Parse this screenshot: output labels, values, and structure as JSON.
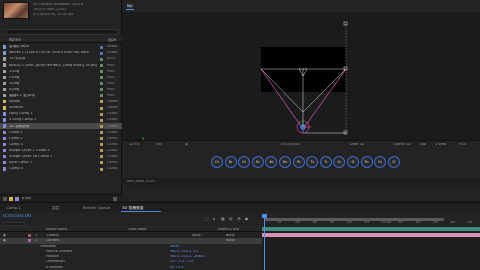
{
  "project": {
    "meta_lines": [
      "3D Camera Animation 2023 ▾",
      "1920 x 1080 (1.00)",
      "Δ 0;00;05;00, 30.00 fps"
    ],
    "header": {
      "name": "Name",
      "type": "Type"
    },
    "items": [
      {
        "name": "香港街.mp4",
        "type": "Video",
        "icon": "video-icon",
        "color": "#7aa0d8",
        "swatch": "#5c6fa8"
      },
      {
        "name": "secret-1 (1280×720 to 1920×1080 hd).mp4",
        "type": "Video",
        "icon": "video-icon",
        "color": "#7aa0d8",
        "swatch": "#5c6fa8"
      },
      {
        "name": "1278.jpg",
        "type": "JPEG",
        "icon": "image-icon",
        "color": "#a0a0a0",
        "swatch": "#6a8a6a"
      },
      {
        "name": "88810-1 (blur, guffy territory, [long shot]), kt.png",
        "type": "PNG",
        "icon": "image-icon",
        "color": "#a0a0a0",
        "swatch": "#6a8a6a"
      },
      {
        "name": "1.png",
        "type": "PNG",
        "icon": "image-icon",
        "color": "#a0a0a0",
        "swatch": "#6a8a6a"
      },
      {
        "name": "2.png",
        "type": "PNG",
        "icon": "image-icon",
        "color": "#a0a0a0",
        "swatch": "#6a8a6a"
      },
      {
        "name": "3.png",
        "type": "PNG",
        "icon": "image-icon",
        "color": "#a0a0a0",
        "swatch": "#6a8a6a"
      },
      {
        "name": "4.png",
        "type": "PNG",
        "icon": "image-icon",
        "color": "#a0a0a0",
        "swatch": "#6a8a6a"
      },
      {
        "name": "縮圖4-1 邊.png",
        "type": "PNG",
        "icon": "image-icon",
        "color": "#a0a0a0",
        "swatch": "#6a8a6a"
      },
      {
        "name": "Solids",
        "type": "Folder",
        "icon": "folder-icon",
        "color": "#d9b84a",
        "swatch": "#c2a03e"
      },
      {
        "name": "untitled",
        "type": "Folder",
        "icon": "folder-icon",
        "color": "#d9b84a",
        "swatch": "#c2a03e"
      },
      {
        "name": "Long Comp 1",
        "type": "Comp",
        "icon": "comp-icon",
        "color": "#8a8ad8",
        "swatch": "#b59a5a"
      },
      {
        "name": "3 Long Comp 1",
        "type": "Comp",
        "icon": "comp-icon",
        "color": "#8a8ad8",
        "swatch": "#b59a5a"
      },
      {
        "name": "3D 相機動畫",
        "type": "Comp",
        "icon": "comp-icon",
        "color": "#8a8ad8",
        "swatch": "#b59a5a",
        "selected": true
      },
      {
        "name": "Comp 1",
        "type": "Comp",
        "icon": "comp-icon",
        "color": "#8a8ad8",
        "swatch": "#b59a5a"
      },
      {
        "name": "Comp 2",
        "type": "Comp",
        "icon": "comp-icon",
        "color": "#8a8ad8",
        "swatch": "#b59a5a"
      },
      {
        "name": "Comp 3",
        "type": "Comp",
        "icon": "comp-icon",
        "color": "#8a8ad8",
        "swatch": "#b59a5a"
      },
      {
        "name": "Shape Layer 1 Comp 1",
        "type": "Comp",
        "icon": "comp-icon",
        "color": "#8a8ad8",
        "swatch": "#b59a5a"
      },
      {
        "name": "Shape Layer 16 Comp 1",
        "type": "Comp",
        "icon": "comp-icon",
        "color": "#8a8ad8",
        "swatch": "#b59a5a"
      },
      {
        "name": "slice Comp 1",
        "type": "Comp",
        "icon": "comp-icon",
        "color": "#8a8ad8",
        "swatch": "#b59a5a"
      },
      {
        "name": "Comp 4",
        "type": "Comp",
        "icon": "comp-icon",
        "color": "#8a8ad8",
        "swatch": "#b59a5a"
      }
    ],
    "footer": {
      "bpc": "8 bpc"
    }
  },
  "viewer": {
    "tab": "Top",
    "toolbar": {
      "zoom": "12.5%",
      "resolution": "Full",
      "timecode": "0;00;00;00",
      "draft": "Draft 3D",
      "renderer": "Classic 3D",
      "view": "Top",
      "views": "1 View",
      "offset": "+0.0"
    },
    "status": "ddm_pack_0230"
  },
  "tools": [
    {
      "label": "Cn",
      "icon": "camera-tool-icon"
    },
    {
      "label": "Br",
      "icon": "brush-tool-icon"
    },
    {
      "label": "Dr",
      "icon": "draw-tool-icon"
    },
    {
      "label": "Rc",
      "icon": "record-tool-icon"
    },
    {
      "label": "Ad",
      "icon": "adjust-tool-icon"
    },
    {
      "label": "Mx",
      "icon": "mix-tool-icon"
    },
    {
      "label": "Rt",
      "icon": "rotate-tool-icon"
    },
    {
      "label": "Tx",
      "icon": "text-tool-icon"
    },
    {
      "label": "Tr",
      "icon": "track-tool-icon"
    },
    {
      "label": "Sc",
      "icon": "scale-tool-icon"
    },
    {
      "label": "Sl",
      "icon": "slice-tool-icon"
    },
    {
      "label": "Pn",
      "icon": "pen-tool-icon"
    },
    {
      "label": "Ex",
      "icon": "expand-tool-icon"
    },
    {
      "label": "Cf",
      "icon": "settings-tool-icon"
    }
  ],
  "timeline": {
    "tabs": [
      {
        "label": "Comp 1",
        "active": false
      },
      {
        "label": "設定",
        "active": false
      },
      {
        "label": "Render Queue",
        "active": false
      },
      {
        "label": "3D 相機動畫",
        "active": true
      }
    ],
    "timecode": "0;00;00;00",
    "columns": [
      "Source Name",
      "Track Matte",
      "Parent & Link"
    ],
    "layers": [
      {
        "index": "1",
        "name": "1-Matte",
        "color": "#a35252",
        "matte": "None",
        "parent": "None",
        "selected": false
      },
      {
        "index": "2",
        "name": "Camera",
        "color": "#b05fa0",
        "matte": "",
        "parent": "None",
        "selected": true
      }
    ],
    "properties": [
      {
        "label": "Transform",
        "value": "Reset"
      },
      {
        "label": "Point of Interest",
        "value": "960.0, 540.0, 0.0"
      },
      {
        "label": "Position",
        "value": "960.0, 540.0, -2666.7"
      },
      {
        "label": "Orientation",
        "value": "0.0°, 0.0°, 0.0°"
      },
      {
        "label": "X Rotation",
        "value": "0x +0.0°"
      }
    ],
    "ruler_ticks": [
      "0f",
      "05f",
      "10f",
      "15f",
      "20f",
      "25f",
      "01:00f",
      "05f",
      "10f",
      "15f",
      "20f",
      "25f"
    ],
    "track_colors": {
      "track1": "#3f8a7c",
      "track2": "#d48fb4",
      "work": "#5a5a5a"
    }
  },
  "colors": {
    "accent": "#4a8ce8",
    "timecode": "#5b8fdd",
    "camera_line": "#c44fa0"
  }
}
